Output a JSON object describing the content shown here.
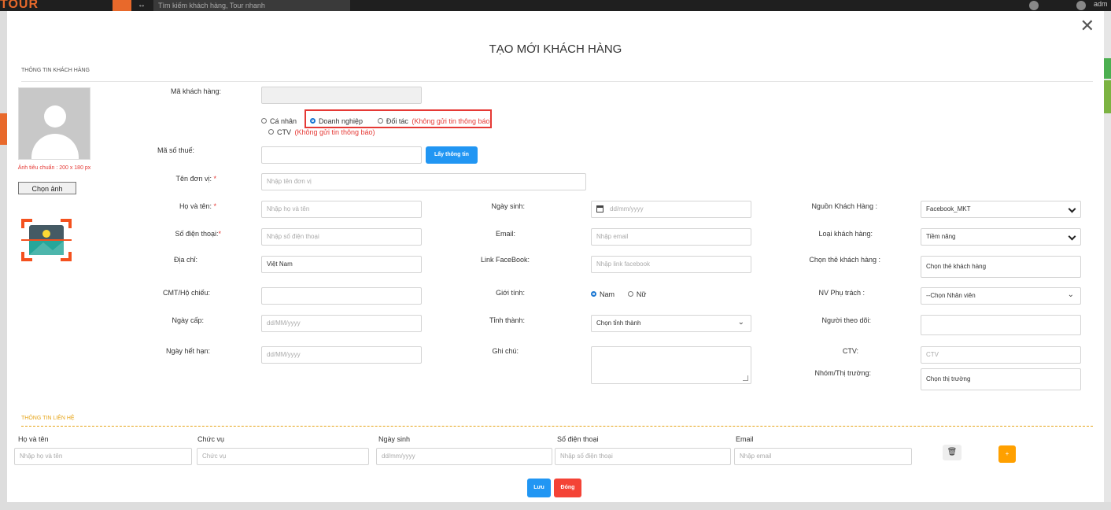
{
  "app": {
    "logo": "TOUR",
    "search_placeholder": "Tìm kiếm khách hàng, Tour nhanh",
    "user": "adm"
  },
  "modal": {
    "title": "TẠO MỚI KHÁCH HÀNG",
    "section_info": "THÔNG TIN KHÁCH HÀNG",
    "image_note": "Ảnh tiêu chuẩn : 200 x 180 px",
    "choose_image": "Chọn ảnh",
    "labels": {
      "customer_code": "Mã khách hàng:",
      "tax_code": "Mã số thuế:",
      "unit_name": "Tên đơn vị:",
      "full_name": "Họ và tên:",
      "phone": "Số điện thoại:",
      "address": "Địa chỉ:",
      "id_card": "CMT/Hộ chiếu:",
      "issue_date": "Ngày cấp:",
      "expiry_date": "Ngày hết hạn:",
      "dob": "Ngày sinh:",
      "email": "Email:",
      "facebook": "Link FaceBook:",
      "gender": "Giới tính:",
      "province": "Tỉnh thành:",
      "note": "Ghi chú:",
      "source": "Nguồn Khách Hàng :",
      "customer_type": "Loại khách hàng:",
      "customer_card": "Chọn thẻ khách hàng :",
      "staff": "NV Phụ trách :",
      "follower": "Người theo dõi:",
      "ctv": "CTV:",
      "group": "Nhóm/Thị trường:"
    },
    "customer_kind": {
      "personal": "Cá nhân",
      "business": "Doanh nghiệp",
      "partner": "Đối tác",
      "partner_note": "(Không gửi tin thông báo)",
      "ctv": "CTV",
      "ctv_note": "(Không gửi tin thông báo)",
      "selected": "Doanh nghiệp"
    },
    "fetch_button": "Lấy thông tin",
    "placeholders": {
      "unit_name": "Nhập tên đơn vị",
      "full_name": "Nhập họ và tên",
      "phone": "Nhập số điện thoại",
      "date": "dd/MM/yyyy",
      "dob": "dd/mm/yyyy",
      "email": "Nhập email",
      "facebook": "Nhập link facebook",
      "ctv": "CTV"
    },
    "values": {
      "address": "Việt Nam",
      "source": "Facebook_MKT",
      "customer_type": "Tiềm năng",
      "customer_card": "Chọn thẻ khách hàng",
      "staff": "--Chọn Nhân viên",
      "province": "Chọn tỉnh thành",
      "group": "Chọn thị trường"
    },
    "gender": {
      "male": "Nam",
      "female": "Nữ",
      "selected": "Nam"
    },
    "contact": {
      "section": "THÔNG TIN LIÊN HỆ",
      "headers": [
        "Họ và tên",
        "Chức vụ",
        "Ngày sinh",
        "Số điện thoại",
        "Email"
      ],
      "placeholders": [
        "Nhập họ và tên",
        "Chức vụ",
        "dd/mm/yyyy",
        "Nhập số điện thoại",
        "Nhập email"
      ]
    },
    "save": "Lưu",
    "close": "Đóng",
    "plus": "+"
  },
  "colors": {
    "primary": "#2196f3",
    "danger": "#f44336",
    "required": "#e53935",
    "accent": "#ffa000"
  }
}
